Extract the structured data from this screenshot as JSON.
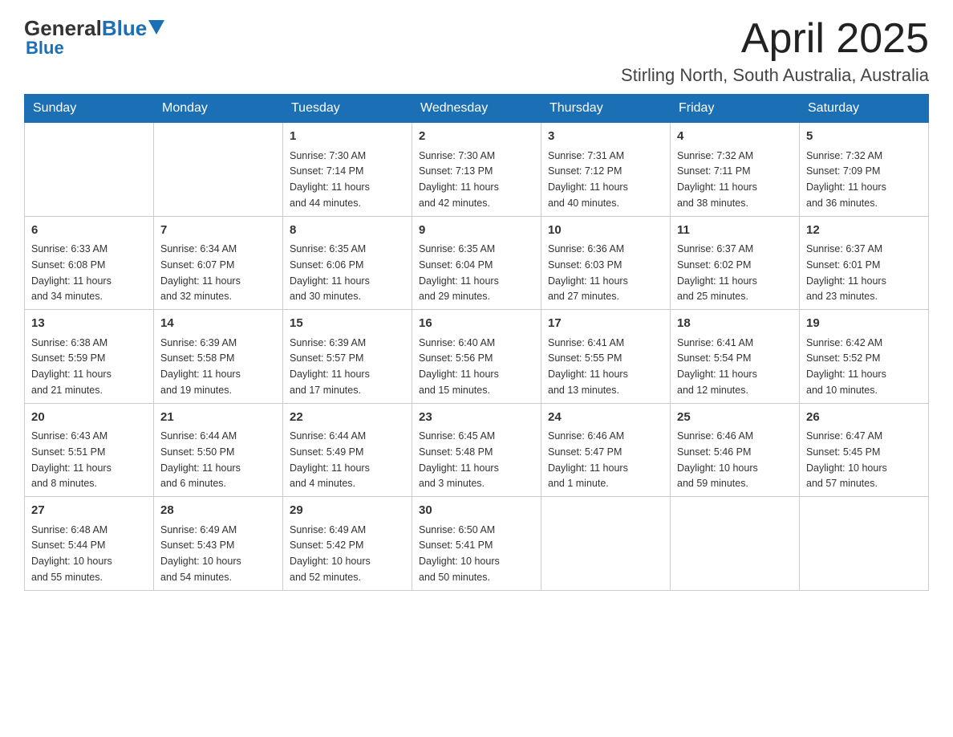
{
  "header": {
    "logo_general": "General",
    "logo_blue": "Blue",
    "month_title": "April 2025",
    "location": "Stirling North, South Australia, Australia"
  },
  "days_of_week": [
    "Sunday",
    "Monday",
    "Tuesday",
    "Wednesday",
    "Thursday",
    "Friday",
    "Saturday"
  ],
  "weeks": [
    [
      {
        "day": "",
        "info": ""
      },
      {
        "day": "",
        "info": ""
      },
      {
        "day": "1",
        "info": "Sunrise: 7:30 AM\nSunset: 7:14 PM\nDaylight: 11 hours\nand 44 minutes."
      },
      {
        "day": "2",
        "info": "Sunrise: 7:30 AM\nSunset: 7:13 PM\nDaylight: 11 hours\nand 42 minutes."
      },
      {
        "day": "3",
        "info": "Sunrise: 7:31 AM\nSunset: 7:12 PM\nDaylight: 11 hours\nand 40 minutes."
      },
      {
        "day": "4",
        "info": "Sunrise: 7:32 AM\nSunset: 7:11 PM\nDaylight: 11 hours\nand 38 minutes."
      },
      {
        "day": "5",
        "info": "Sunrise: 7:32 AM\nSunset: 7:09 PM\nDaylight: 11 hours\nand 36 minutes."
      }
    ],
    [
      {
        "day": "6",
        "info": "Sunrise: 6:33 AM\nSunset: 6:08 PM\nDaylight: 11 hours\nand 34 minutes."
      },
      {
        "day": "7",
        "info": "Sunrise: 6:34 AM\nSunset: 6:07 PM\nDaylight: 11 hours\nand 32 minutes."
      },
      {
        "day": "8",
        "info": "Sunrise: 6:35 AM\nSunset: 6:06 PM\nDaylight: 11 hours\nand 30 minutes."
      },
      {
        "day": "9",
        "info": "Sunrise: 6:35 AM\nSunset: 6:04 PM\nDaylight: 11 hours\nand 29 minutes."
      },
      {
        "day": "10",
        "info": "Sunrise: 6:36 AM\nSunset: 6:03 PM\nDaylight: 11 hours\nand 27 minutes."
      },
      {
        "day": "11",
        "info": "Sunrise: 6:37 AM\nSunset: 6:02 PM\nDaylight: 11 hours\nand 25 minutes."
      },
      {
        "day": "12",
        "info": "Sunrise: 6:37 AM\nSunset: 6:01 PM\nDaylight: 11 hours\nand 23 minutes."
      }
    ],
    [
      {
        "day": "13",
        "info": "Sunrise: 6:38 AM\nSunset: 5:59 PM\nDaylight: 11 hours\nand 21 minutes."
      },
      {
        "day": "14",
        "info": "Sunrise: 6:39 AM\nSunset: 5:58 PM\nDaylight: 11 hours\nand 19 minutes."
      },
      {
        "day": "15",
        "info": "Sunrise: 6:39 AM\nSunset: 5:57 PM\nDaylight: 11 hours\nand 17 minutes."
      },
      {
        "day": "16",
        "info": "Sunrise: 6:40 AM\nSunset: 5:56 PM\nDaylight: 11 hours\nand 15 minutes."
      },
      {
        "day": "17",
        "info": "Sunrise: 6:41 AM\nSunset: 5:55 PM\nDaylight: 11 hours\nand 13 minutes."
      },
      {
        "day": "18",
        "info": "Sunrise: 6:41 AM\nSunset: 5:54 PM\nDaylight: 11 hours\nand 12 minutes."
      },
      {
        "day": "19",
        "info": "Sunrise: 6:42 AM\nSunset: 5:52 PM\nDaylight: 11 hours\nand 10 minutes."
      }
    ],
    [
      {
        "day": "20",
        "info": "Sunrise: 6:43 AM\nSunset: 5:51 PM\nDaylight: 11 hours\nand 8 minutes."
      },
      {
        "day": "21",
        "info": "Sunrise: 6:44 AM\nSunset: 5:50 PM\nDaylight: 11 hours\nand 6 minutes."
      },
      {
        "day": "22",
        "info": "Sunrise: 6:44 AM\nSunset: 5:49 PM\nDaylight: 11 hours\nand 4 minutes."
      },
      {
        "day": "23",
        "info": "Sunrise: 6:45 AM\nSunset: 5:48 PM\nDaylight: 11 hours\nand 3 minutes."
      },
      {
        "day": "24",
        "info": "Sunrise: 6:46 AM\nSunset: 5:47 PM\nDaylight: 11 hours\nand 1 minute."
      },
      {
        "day": "25",
        "info": "Sunrise: 6:46 AM\nSunset: 5:46 PM\nDaylight: 10 hours\nand 59 minutes."
      },
      {
        "day": "26",
        "info": "Sunrise: 6:47 AM\nSunset: 5:45 PM\nDaylight: 10 hours\nand 57 minutes."
      }
    ],
    [
      {
        "day": "27",
        "info": "Sunrise: 6:48 AM\nSunset: 5:44 PM\nDaylight: 10 hours\nand 55 minutes."
      },
      {
        "day": "28",
        "info": "Sunrise: 6:49 AM\nSunset: 5:43 PM\nDaylight: 10 hours\nand 54 minutes."
      },
      {
        "day": "29",
        "info": "Sunrise: 6:49 AM\nSunset: 5:42 PM\nDaylight: 10 hours\nand 52 minutes."
      },
      {
        "day": "30",
        "info": "Sunrise: 6:50 AM\nSunset: 5:41 PM\nDaylight: 10 hours\nand 50 minutes."
      },
      {
        "day": "",
        "info": ""
      },
      {
        "day": "",
        "info": ""
      },
      {
        "day": "",
        "info": ""
      }
    ]
  ]
}
